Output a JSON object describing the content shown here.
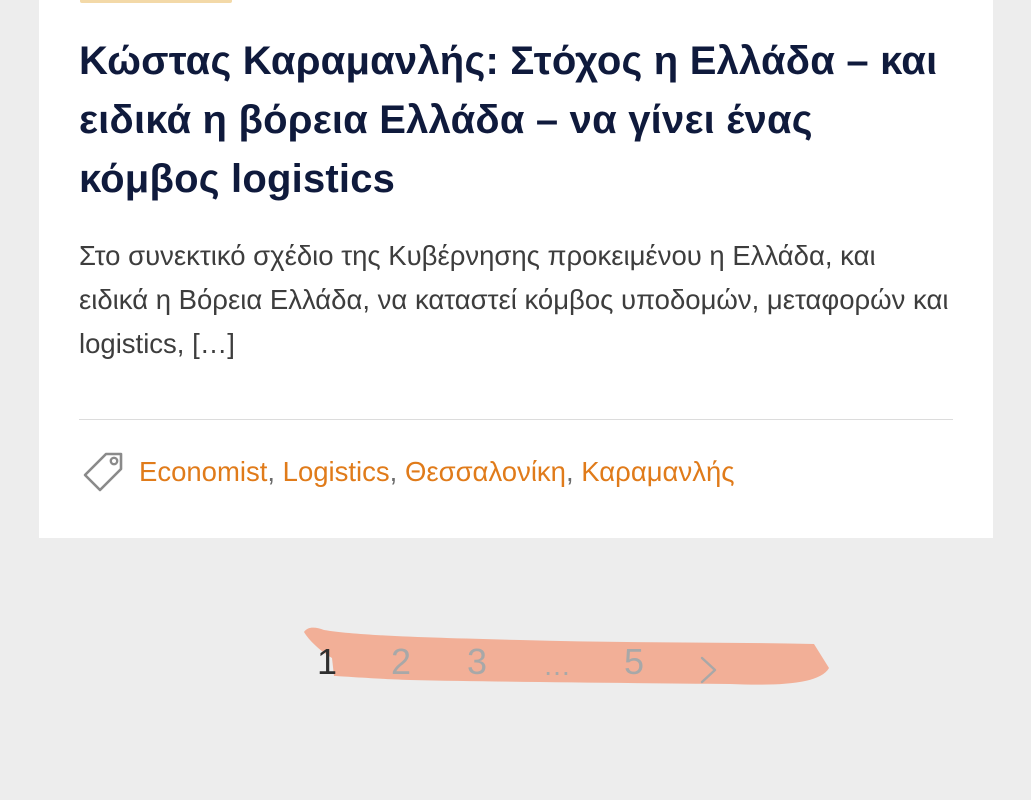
{
  "article": {
    "title": "Κώστας Καραμανλής: Στόχος η Ελλάδα – και ειδικά η βόρεια Ελλάδα – να γίνει ένας κόμβος logistics",
    "excerpt": "Στο συνεκτικό σχέδιο της Κυβέρνησης προκειμένου η Ελλάδα, και ειδικά η Βόρεια Ελλάδα, να καταστεί κόμβος υποδομών, μεταφορών και logistics, […]",
    "tags_icon": "tag-icon",
    "tags": [
      "Economist",
      "Logistics",
      "Θεσσαλονίκη",
      "Καραμανλής"
    ],
    "tag_separator": ","
  },
  "pagination": {
    "pages": [
      "1",
      "2",
      "3",
      "5"
    ],
    "current": "1",
    "ellipsis": "…",
    "next_icon": "chevron-right-icon"
  },
  "colors": {
    "background": "#ededed",
    "card": "#ffffff",
    "title": "#0f1a3c",
    "body_text": "#3d3d3d",
    "tag_link": "#e07b1a",
    "pagination_inactive": "#a8a8a8",
    "pagination_active": "#2f2f2f",
    "highlight_mark": "#f2a387"
  }
}
